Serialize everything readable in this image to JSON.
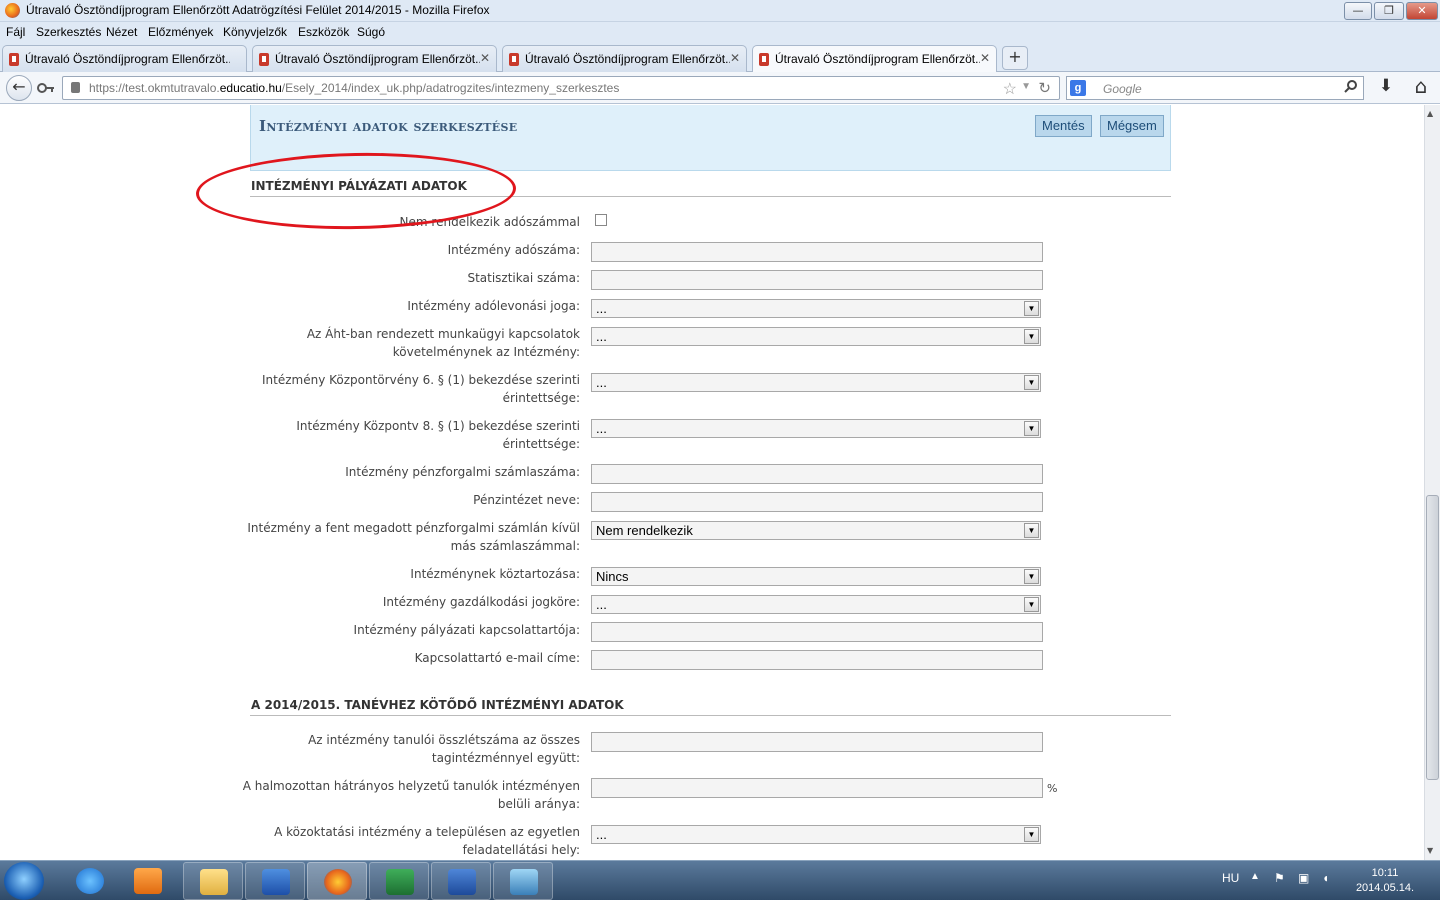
{
  "window": {
    "title": "Útravaló Ösztöndíjprogram Ellenőrzött Adatrögzítési Felület 2014/2015 - Mozilla Firefox",
    "minimize": "—",
    "maximize": "❐",
    "close": "✕"
  },
  "menu": [
    "Fájl",
    "Szerkesztés",
    "Nézet",
    "Előzmények",
    "Könyvjelzők",
    "Eszközök",
    "Súgó"
  ],
  "tabs": [
    {
      "label": "Útravaló Ösztöndíjprogram Ellenőrzöt...",
      "close": "✕"
    },
    {
      "label": "Útravaló Ösztöndíjprogram Ellenőrzöt...",
      "close": "✕"
    },
    {
      "label": "Útravaló Ösztöndíjprogram Ellenőrzöt...",
      "close": "✕"
    },
    {
      "label": "Útravaló Ösztöndíjprogram Ellenőrzöt...",
      "close": "✕"
    }
  ],
  "new_tab": "+",
  "nav": {
    "url_prefix": "https://test.okmtutravalo.",
    "url_domain": "educatio.hu",
    "url_path": "/Esely_2014/index_uk.php/adatrogzites/intezmeny_szerkesztes",
    "search_placeholder": "Google",
    "back": "←",
    "star": "☆",
    "reload": "↻",
    "download": "⬇",
    "home": "⌂"
  },
  "page": {
    "header_title": "Intézményi adatok szerkesztése",
    "save_label": "Mentés",
    "cancel_label": "Mégsem",
    "section1_title": "INTÉZMÉNYI PÁLYÁZATI ADATOK",
    "section2_title": "A 2014/2015. TANÉVHEZ KÖTŐDŐ INTÉZMÉNYI ADATOK",
    "fields1": {
      "no_tax": "Nem rendelkezik adószámmal",
      "tax_number": "Intézmény adószáma:",
      "stat_number": "Statisztikai száma:",
      "tax_deduction": "Intézmény adólevonási joga:",
      "aht_l1": "Az Áht-ban rendezett munkaügyi kapcsolatok",
      "aht_l2": "követelménynek az Intézmény:",
      "kp6_l1": "Intézmény Központörvény 6. § (1) bekezdése szerinti",
      "kp6_l2": "érintettsége:",
      "kp8_l1": "Intézmény Központv 8. § (1) bekezdése szerinti",
      "kp8_l2": "érintettsége:",
      "account": "Intézmény pénzforgalmi számlaszáma:",
      "bank": "Pénzintézet neve:",
      "other_l1": "Intézmény a fent megadott pénzforgalmi számlán kívül",
      "other_l2": "más számlaszámmal:",
      "debt": "Intézménynek köztartozása:",
      "legal": "Intézmény gazdálkodási jogköre:",
      "contact": "Intézmény pályázati kapcsolattartója:",
      "email": "Kapcsolattartó e-mail címe:"
    },
    "values1": {
      "tax_deduction": "...",
      "aht": "...",
      "kp6": "...",
      "kp8": "...",
      "other": "Nem rendelkezik",
      "debt": "Nincs",
      "legal": "..."
    },
    "fields2": {
      "students_l1": "Az intézmény tanulói összlétszáma az összes",
      "students_l2": "tagintézménnyel együtt:",
      "disadv_l1": "A halmozottan hátrányos helyzetű tanulók intézményen",
      "disadv_l2": "belüli aránya:",
      "public_l1": "A közoktatási intézmény a településen az egyetlen",
      "public_l2": "feladatellátási hely:"
    },
    "values2": {
      "percent": "%",
      "public": "..."
    },
    "dropdown_arrow": "▼"
  },
  "taskbar": {
    "lang": "HU",
    "time": "10:11",
    "date": "2014.05.14."
  },
  "colors": {
    "annotation": "#e0161d",
    "header_bg": "#dff0fa",
    "button_bg": "#b9d7ec"
  }
}
